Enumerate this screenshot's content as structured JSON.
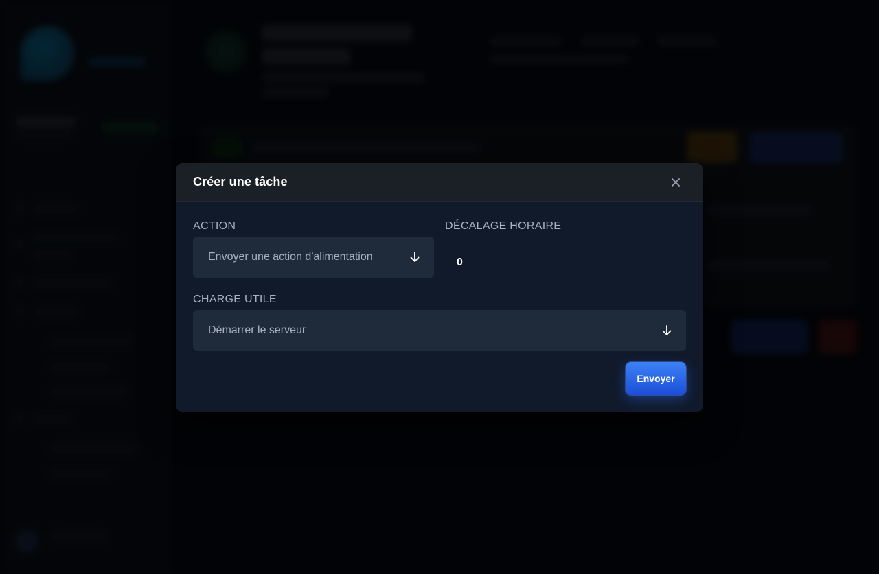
{
  "modal": {
    "title": "Créer une tâche",
    "close_icon": "close-icon",
    "action_label": "ACTION",
    "action_value": "Envoyer une action d'alimentation",
    "offset_label": "DÉCALAGE HORAIRE",
    "offset_value": "0",
    "payload_label": "CHARGE UTILE",
    "payload_value": "Démarrer le serveur",
    "submit_label": "Envoyer",
    "dropdown_icon": "arrow-down-icon"
  },
  "colors": {
    "modal_bg": "#111a2b",
    "header_bg": "#1b1f26",
    "field_bg": "#1f2a3b",
    "accent": "#3b82f6"
  }
}
